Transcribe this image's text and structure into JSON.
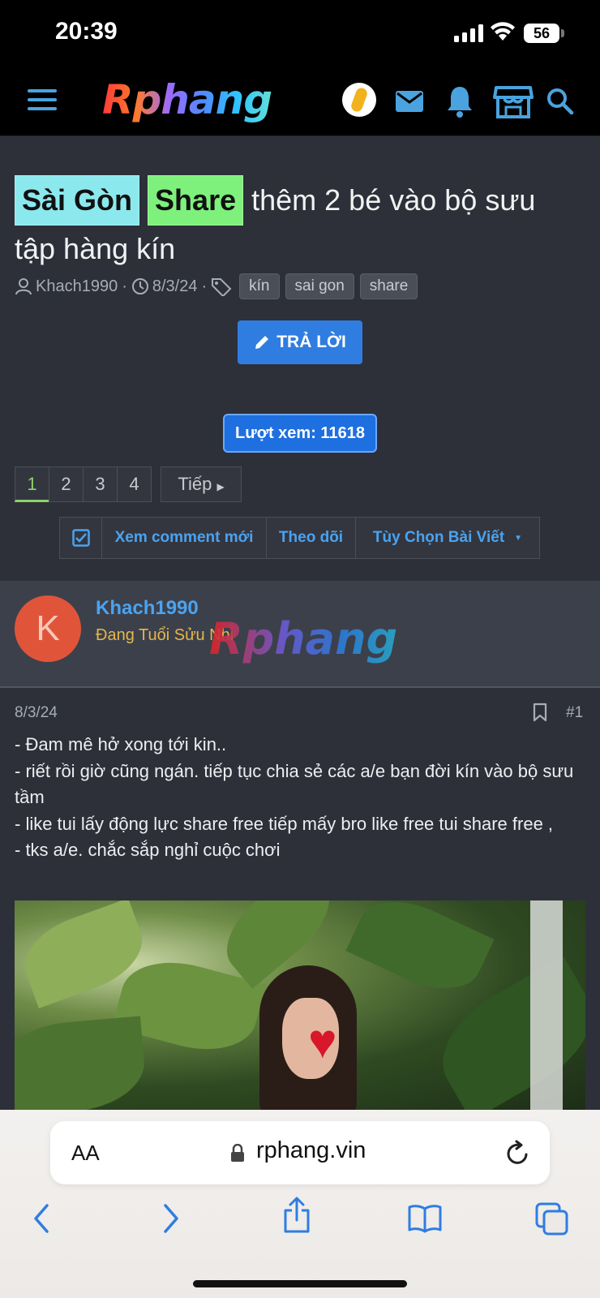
{
  "status": {
    "time": "20:39",
    "battery": "56"
  },
  "header": {
    "logo": "Rphang",
    "icons": [
      "menu-icon",
      "user-avatar",
      "mail-icon",
      "bell-icon",
      "store-icon",
      "search-icon"
    ]
  },
  "thread": {
    "prefix_1": "Sài Gòn",
    "prefix_2": "Share",
    "title": "thêm 2 bé vào bộ sưu tập hàng kín",
    "author": "Khach1990",
    "date": "8/3/24",
    "tags": [
      "kín",
      "sai gon",
      "share"
    ],
    "reply_label": "TRẢ LỜI",
    "views_label": "Lượt xem: 11618",
    "pages": [
      "1",
      "2",
      "3",
      "4"
    ],
    "current_page": "1",
    "next_label": "Tiếp",
    "actions": {
      "new_comments": "Xem comment mới",
      "follow": "Theo dõi",
      "options": "Tùy Chọn Bài Viết"
    }
  },
  "post": {
    "avatar_letter": "K",
    "author": "Khach1990",
    "rank": "Đang Tuổi Sửu Nhi",
    "watermark": "Rphang",
    "date": "8/3/24",
    "number": "#1",
    "lines": [
      "- Đam mê hở xong tới kin..",
      "- riết rồi giờ cũng ngán. tiếp tục chia sẻ các a/e bạn đời kín vào bộ sưu tầm",
      "- like tui lấy động lực share free tiếp mấy bro like free tui share free ,",
      "- tks a/e. chắc sắp nghỉ cuộc chơi"
    ]
  },
  "browser": {
    "aa_label": "AA",
    "url": "rphang.vin",
    "toolbar": [
      "back-icon",
      "forward-icon",
      "share-icon",
      "bookmarks-icon",
      "tabs-icon"
    ]
  },
  "colors": {
    "accent_blue": "#2f7de1",
    "link_blue": "#4aa3f0",
    "prefix_cyan": "#8be9ee",
    "prefix_green": "#7ef07c",
    "rank_gold": "#e6b64a",
    "page_bg": "#2d3039"
  }
}
